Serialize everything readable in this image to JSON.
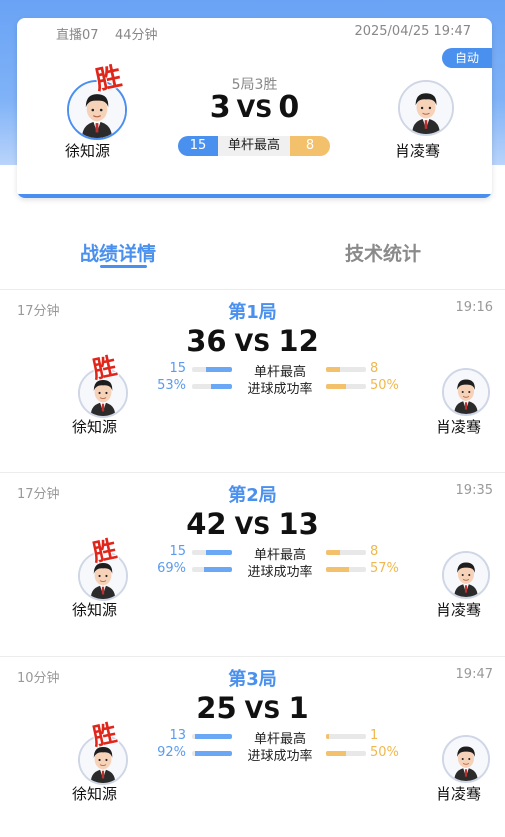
{
  "header": {
    "channel": "直播07",
    "duration": "44分钟",
    "datetime": "2025/04/25 19:47",
    "auto_label": "自动",
    "frames_result": "5局3胜",
    "score_left": "3",
    "score_right": "0",
    "vs": "VS",
    "best_break_left": "15",
    "best_break_label": "单杆最高",
    "best_break_right": "8",
    "win_mark": "胜"
  },
  "players": {
    "left": "徐知源",
    "right": "肖凌骞"
  },
  "tabs": [
    {
      "label": "战绩详情",
      "active": true
    },
    {
      "label": "技术统计",
      "active": false
    }
  ],
  "games": [
    {
      "duration": "17分钟",
      "title": "第1局",
      "time": "19:16",
      "score_left": "36",
      "score_right": "12",
      "win_mark": "胜",
      "stats": [
        {
          "label": "单杆最高",
          "left": "15",
          "right": "8",
          "left_frac": 0.65,
          "right_frac": 0.35
        },
        {
          "label": "进球成功率",
          "left": "53%",
          "right": "50%",
          "left_frac": 0.53,
          "right_frac": 0.5
        }
      ]
    },
    {
      "duration": "17分钟",
      "title": "第2局",
      "time": "19:35",
      "score_left": "42",
      "score_right": "13",
      "win_mark": "胜",
      "stats": [
        {
          "label": "单杆最高",
          "left": "15",
          "right": "8",
          "left_frac": 0.65,
          "right_frac": 0.35
        },
        {
          "label": "进球成功率",
          "left": "69%",
          "right": "57%",
          "left_frac": 0.69,
          "right_frac": 0.57
        }
      ]
    },
    {
      "duration": "10分钟",
      "title": "第3局",
      "time": "19:47",
      "score_left": "25",
      "score_right": "1",
      "win_mark": "胜",
      "stats": [
        {
          "label": "单杆最高",
          "left": "13",
          "right": "1",
          "left_frac": 0.93,
          "right_frac": 0.07
        },
        {
          "label": "进球成功率",
          "left": "92%",
          "right": "50%",
          "left_frac": 0.92,
          "right_frac": 0.5
        }
      ]
    }
  ],
  "colors": {
    "accent_blue": "#4a90ee",
    "accent_orange": "#f3c06b",
    "win_red": "#e0261b"
  }
}
